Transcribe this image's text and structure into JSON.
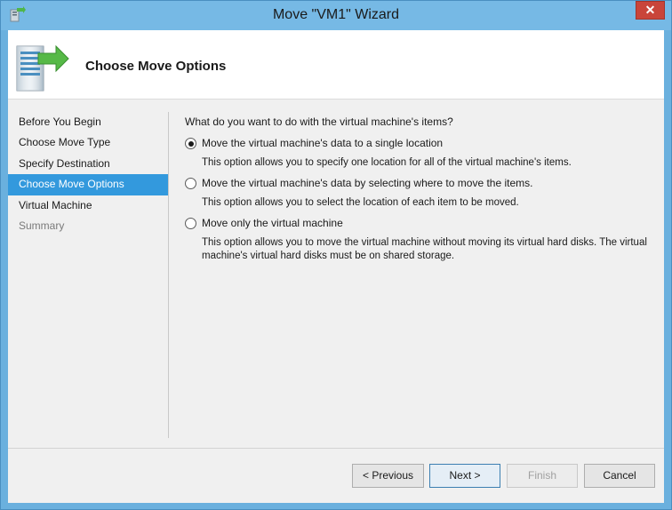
{
  "window": {
    "title": "Move \"VM1\" Wizard",
    "close_glyph": "✕"
  },
  "header": {
    "title": "Choose Move Options",
    "icon": "server-move-icon"
  },
  "nav": {
    "items": [
      {
        "label": "Before You Begin",
        "state": "normal"
      },
      {
        "label": "Choose Move Type",
        "state": "normal"
      },
      {
        "label": "Specify Destination",
        "state": "normal"
      },
      {
        "label": "Choose Move Options",
        "state": "active"
      },
      {
        "label": "Virtual Machine",
        "state": "normal"
      },
      {
        "label": "Summary",
        "state": "disabled"
      }
    ]
  },
  "content": {
    "question": "What do you want to do with the virtual machine's items?",
    "options": [
      {
        "label": "Move the virtual machine's data to a single location",
        "description": "This option allows you to specify one location for all of the virtual machine's items.",
        "selected": true
      },
      {
        "label": "Move the virtual machine's data by selecting where to move the items.",
        "description": "This option allows you to select the location of each item to be moved.",
        "selected": false
      },
      {
        "label": "Move only the virtual machine",
        "description": "This option allows you to move the virtual machine without moving its virtual hard disks. The virtual machine's virtual hard disks must be on shared storage.",
        "selected": false
      }
    ]
  },
  "buttons": {
    "previous": "< Previous",
    "next": "Next >",
    "finish": "Finish",
    "cancel": "Cancel"
  },
  "colors": {
    "titlebar": "#76b9e5",
    "nav_active": "#3399dd",
    "close": "#c9453a"
  }
}
